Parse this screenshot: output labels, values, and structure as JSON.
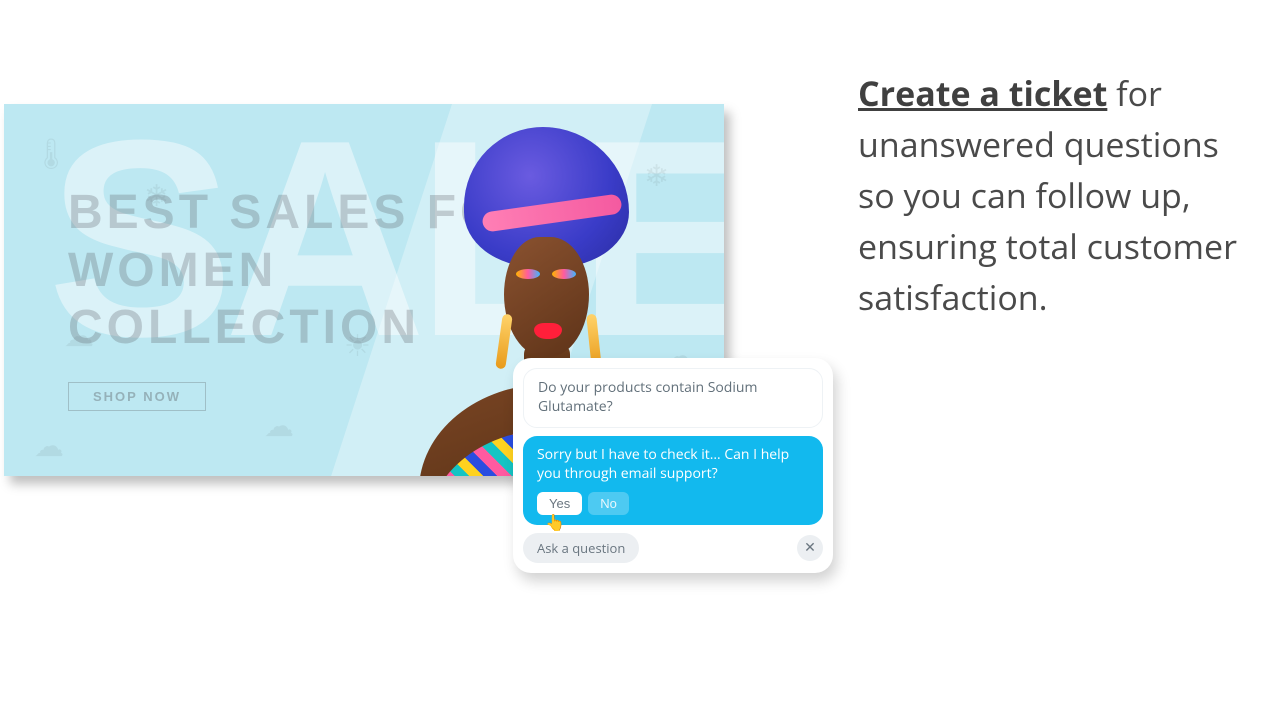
{
  "hero": {
    "bg_word": "SALE",
    "headline_l1": "BEST SALES FOR",
    "headline_l2": "WOMEN",
    "headline_l3": "COLLECTION",
    "cta": "SHOP NOW"
  },
  "chat": {
    "user_msg": "Do your products contain Sodium Glutamate?",
    "bot_msg": "Sorry but I have to check it… Can I help you through email support?",
    "yes": "Yes",
    "no": "No",
    "suggestion": "Ask a question",
    "close": "✕"
  },
  "copy": {
    "headline": "Create a ticket",
    "body": " for unanswered questions so you can follow up, ensuring total customer satisfaction."
  }
}
